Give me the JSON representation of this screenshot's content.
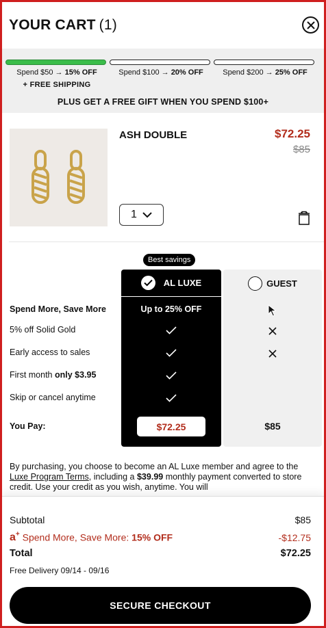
{
  "header": {
    "title": "YOUR CART",
    "count": "(1)"
  },
  "promo": {
    "tiers": [
      {
        "label": "Spend $50 → ",
        "value": "15% OFF"
      },
      {
        "label": "Spend $100 → ",
        "value": "20% OFF"
      },
      {
        "label": "Spend $200 → ",
        "value": "25% OFF"
      }
    ],
    "tier1_sub": "+ FREE SHIPPING",
    "progress_active_tiers": 1,
    "gift": "PLUS GET A FREE GIFT WHEN YOU SPEND $100+"
  },
  "item": {
    "name": "ASH DOUBLE",
    "price": "$72.25",
    "old_price": "$85",
    "qty": "1"
  },
  "compare": {
    "badge": "Best savings",
    "luxe_label": "AL LUXE",
    "guest_label": "GUEST",
    "rows": [
      {
        "label": "Spend More, Save More",
        "luxe": "Up to 25% OFF",
        "guest": ""
      },
      {
        "label": "5% off Solid Gold",
        "luxe": "check",
        "guest": "x"
      },
      {
        "label": "Early access to sales",
        "luxe": "check",
        "guest": "x"
      },
      {
        "label_a": "First month ",
        "label_b": "only $3.95",
        "luxe": "check",
        "guest": ""
      },
      {
        "label": "Skip or cancel anytime",
        "luxe": "check",
        "guest": ""
      }
    ],
    "you_pay_label": "You Pay:",
    "you_pay_luxe": "$72.25",
    "you_pay_guest": "$85"
  },
  "legal": {
    "p1": "By purchasing, you choose to become an AL Luxe member and agree to the ",
    "link": "Luxe Program Terms",
    "p2": ", including a ",
    "amount": "$39.99",
    "p3": " monthly payment converted to store credit. Use your credit as you wish, anytime. You will"
  },
  "summary": {
    "subtotal_label": "Subtotal",
    "subtotal": "$85",
    "discount_label": "Spend More, Save More: ",
    "discount_pct": "15% OFF",
    "discount": "-$12.75",
    "total_label": "Total",
    "total": "$72.25",
    "delivery": "Free Delivery 09/14 - 09/16"
  },
  "checkout_label": "SECURE CHECKOUT",
  "colors": {
    "accent_red": "#b22d1c",
    "progress_green": "#3bbd4a",
    "frame_red": "#cf1f1f"
  }
}
